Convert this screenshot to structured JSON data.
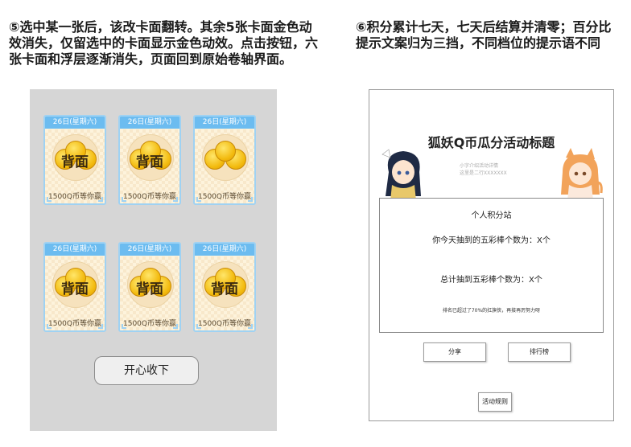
{
  "notes": {
    "left": "⑤选中某一张后，该改卡面翻转。其余5张卡面金色动效消失，仅留选中的卡面显示金色动效。点击按钮，六张卡面和浮层逐渐消失，页面回到原始卷轴界面。",
    "right": "⑥积分累计七天，七天后结算并清零；百分比提示文案归为三挡，不同档位的提示语不同"
  },
  "cards": [
    {
      "date": "26日(星期六)",
      "face": "背面",
      "prize": "1500Q币等你赢",
      "face_visible": true
    },
    {
      "date": "26日(星期六)",
      "face": "背面",
      "prize": "1500Q币等你赢",
      "face_visible": true
    },
    {
      "date": "26日(星期六)",
      "face": "",
      "prize": "1500Q币等你赢",
      "face_visible": false
    },
    {
      "date": "26日(星期六)",
      "face": "背面",
      "prize": "1500Q币等你赢",
      "face_visible": true
    },
    {
      "date": "26日(星期六)",
      "face": "背面",
      "prize": "1500Q币等你赢",
      "face_visible": true
    },
    {
      "date": "26日(星期六)",
      "face": "背面",
      "prize": "1500Q币等你赢",
      "face_visible": true
    }
  ],
  "happy_button": "开心收下",
  "activity": {
    "title": "狐妖Q币瓜分活动标题",
    "subtitle_line1": "小字介绍活动详情",
    "subtitle_line2": "这里是二行XXXXXXX",
    "box_title": "个人积分站",
    "today_line": "你今天抽到的五彩棒个数为：X个",
    "total_line": "总计抽到五彩棒个数为：X个",
    "hint": "排名已超过了70%的扛旗侠，再接再厉努力呀",
    "share": "分享",
    "ranking": "排行榜",
    "rules": "活动规则"
  },
  "colors": {
    "card_header": "#6cbcf0",
    "card_border": "#9fd2f3",
    "card_bg": "#fdf3dc",
    "coin": "#f2b90c",
    "mock_bg": "#d6d6d6"
  }
}
